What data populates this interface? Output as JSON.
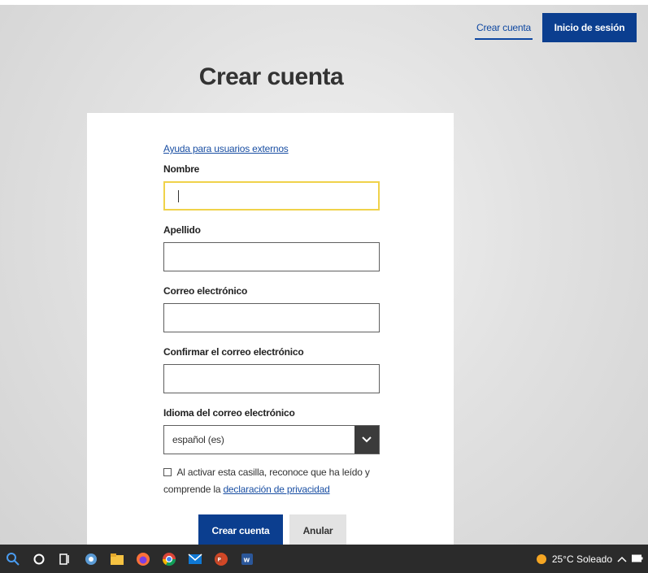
{
  "header": {
    "create_account_link": "Crear cuenta",
    "login_button": "Inicio de sesión"
  },
  "page": {
    "title": "Crear cuenta"
  },
  "form": {
    "help_link": "Ayuda para usuarios externos",
    "first_name_label": "Nombre",
    "first_name_value": "",
    "last_name_label": "Apellido",
    "last_name_value": "",
    "email_label": "Correo electrónico",
    "email_value": "",
    "confirm_email_label": "Confirmar el correo electrónico",
    "confirm_email_value": "",
    "email_language_label": "Idioma del correo electrónico",
    "email_language_selected": "español (es)",
    "consent_checked": false,
    "consent_text_before": "Al activar esta casilla, reconoce que ha leído y comprende la",
    "privacy_link": "declaración de privacidad",
    "submit_button": "Crear cuenta",
    "cancel_button": "Anular"
  },
  "taskbar": {
    "icons": [
      "search-icon",
      "cortana-icon",
      "task-view-icon",
      "teams-icon",
      "file-explorer-icon",
      "firefox-icon",
      "chrome-icon",
      "mail-icon",
      "powerpoint-icon",
      "word-icon"
    ],
    "weather": "25°C Soleado"
  },
  "colors": {
    "primary": "#0b3e8f",
    "link": "#1a4fa3",
    "focus_border": "#f0d24a",
    "secondary_button": "#e3e3e3"
  }
}
